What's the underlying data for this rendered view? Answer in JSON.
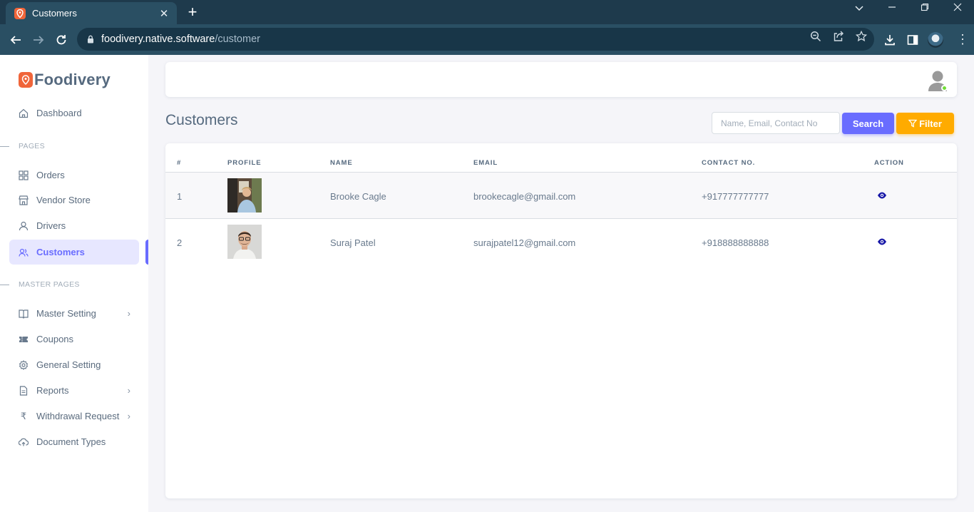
{
  "browser": {
    "tab_title": "Customers",
    "url_host": "foodivery.native.software",
    "url_path": "/customer"
  },
  "sidebar": {
    "brand": "Foodivery",
    "dashboard": "Dashboard",
    "section_pages": "PAGES",
    "items_pages": [
      {
        "label": "Orders",
        "icon": "grid-icon"
      },
      {
        "label": "Vendor Store",
        "icon": "store-icon"
      },
      {
        "label": "Drivers",
        "icon": "user-icon"
      },
      {
        "label": "Customers",
        "icon": "users-icon",
        "active": true
      }
    ],
    "section_master": "MASTER PAGES",
    "items_master": [
      {
        "label": "Master Setting",
        "icon": "book-icon",
        "has_submenu": true
      },
      {
        "label": "Coupons",
        "icon": "ticket-icon"
      },
      {
        "label": "General Setting",
        "icon": "gear-icon"
      },
      {
        "label": "Reports",
        "icon": "report-icon",
        "has_submenu": true
      },
      {
        "label": "Withdrawal Request",
        "icon": "rupee-icon",
        "has_submenu": true
      },
      {
        "label": "Document Types",
        "icon": "cloud-upload-icon"
      }
    ]
  },
  "main": {
    "title": "Customers",
    "search_placeholder": "Name, Email, Contact No",
    "search_button": "Search",
    "filter_button": "Filter"
  },
  "table": {
    "headers": [
      "#",
      "PROFILE",
      "NAME",
      "EMAIL",
      "CONTACT NO.",
      "ACTION"
    ],
    "rows": [
      {
        "num": "1",
        "name": "Brooke Cagle",
        "email": "brookecagle@gmail.com",
        "contact": "+917777777777"
      },
      {
        "num": "2",
        "name": "Suraj Patel",
        "email": "surajpatel12@gmail.com",
        "contact": "+918888888888"
      }
    ]
  },
  "colors": {
    "primary": "#696cff",
    "warning": "#ffab00",
    "brand": "#f0653a",
    "online": "#71dd37"
  }
}
